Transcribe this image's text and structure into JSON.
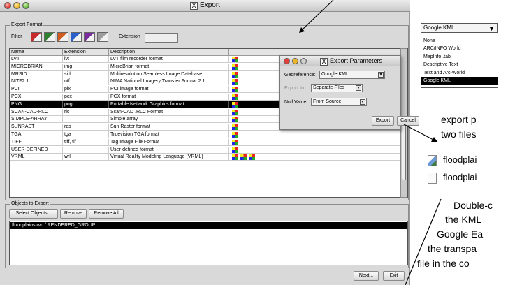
{
  "window": {
    "title": "Export"
  },
  "export_format": {
    "group_label": "Export Format",
    "filter_label": "Filter",
    "extension_label": "Extension",
    "extension_value": "",
    "filter_swatches": [
      "#c62a2a",
      "#2f7f2f",
      "#d35b1c",
      "#2b5fc9",
      "#7a2b9c",
      "#9e9e9e"
    ],
    "columns": [
      "Name",
      "Extension",
      "Description"
    ],
    "rows": [
      {
        "name": "LVT",
        "ext": "lvt",
        "desc": "LVT film recorder format",
        "icons": 1
      },
      {
        "name": "MICROBRIAN",
        "ext": "img",
        "desc": "MicroBrian format",
        "icons": 1
      },
      {
        "name": "MRSID",
        "ext": "sid",
        "desc": "Multiresolution Seamless Image Database",
        "icons": 1
      },
      {
        "name": "NITF2.1",
        "ext": "ntf",
        "desc": "NIMA National Imagery Transfer Format 2.1",
        "icons": 1
      },
      {
        "name": "PCI",
        "ext": "pix",
        "desc": "PCI image format",
        "icons": 1
      },
      {
        "name": "PCX",
        "ext": "pcx",
        "desc": "PCX format",
        "icons": 1
      },
      {
        "name": "PNG",
        "ext": "png",
        "desc": "Portable Network Graphics format",
        "icons": 1,
        "selected": true
      },
      {
        "name": "SCAN-CAD-RLC",
        "ext": "rlc",
        "desc": "Scan-CAD .RLC Format",
        "icons": 1
      },
      {
        "name": "SIMPLE-ARRAY",
        "ext": "",
        "desc": "Simple array",
        "icons": 1
      },
      {
        "name": "SUNRAST",
        "ext": "ras",
        "desc": "Sun Raster format",
        "icons": 1
      },
      {
        "name": "TGA",
        "ext": "tga",
        "desc": "Truevision TGA format",
        "icons": 1
      },
      {
        "name": "TIFF",
        "ext": "tiff, tif",
        "desc": "Tag Image File Format",
        "icons": 1
      },
      {
        "name": "USER-DEFINED",
        "ext": "",
        "desc": "User-defined format",
        "icons": 1
      },
      {
        "name": "VRML",
        "ext": "wrl",
        "desc": "Virtual Reality Modeling Language (VRML)",
        "icons": 3
      }
    ]
  },
  "objects": {
    "group_label": "Objects to Export",
    "select_button": "Select Objects...",
    "remove_button": "Remove",
    "remove_all_button": "Remove All",
    "items": [
      "floodplains.rvc / RENDERED_GROUP"
    ]
  },
  "footer": {
    "next_button": "Next...",
    "exit_button": "Exit"
  },
  "dialog": {
    "title": "Export Parameters",
    "georef_label": "Georeference:",
    "georef_value": "Google KML",
    "export_to_label": "Export to:",
    "export_to_value": "Separate Files",
    "null_label": "Null Value",
    "null_value": "From Source",
    "export_button": "Export",
    "cancel_button": "Cancel"
  },
  "dropdown": {
    "value": "Google KML",
    "options": [
      "None",
      "ARC/INFO World",
      "MapInfo .tab",
      "Descriptive Text",
      "Text and Arc-World",
      "Google KML"
    ],
    "selected_index": 5
  },
  "annotations": {
    "line1": "export p",
    "line2": "two files",
    "file1": "floodplai",
    "file2": "floodplai",
    "line3": "Double-c",
    "line4": "the KML",
    "line5": "Google Ea",
    "line6": "the transpa",
    "line7": "file in the co"
  }
}
